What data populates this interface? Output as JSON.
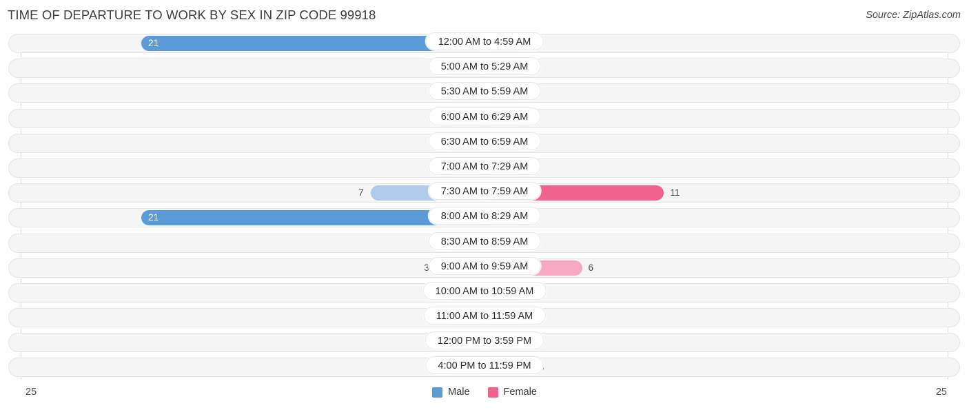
{
  "header": {
    "title": "TIME OF DEPARTURE TO WORK BY SEX IN ZIP CODE 99918",
    "source": "Source: ZipAtlas.com"
  },
  "legend": {
    "male_label": "Male",
    "female_label": "Female",
    "male_color": "#5b9bd8",
    "female_color": "#f2628e"
  },
  "axis": {
    "min_label": "25",
    "max_label": "25",
    "scale_max": 25
  },
  "colors": {
    "male_strong": "#5b9bd8",
    "male_light": "#aecbec",
    "female_strong": "#f2628e",
    "female_light": "#f9a8c4"
  },
  "chart_data": {
    "type": "bar",
    "title": "TIME OF DEPARTURE TO WORK BY SEX IN ZIP CODE 99918",
    "subtitle": "Source: ZipAtlas.com",
    "orientation": "horizontal-diverging",
    "xlabel": "",
    "ylabel": "",
    "xlim": [
      25,
      25
    ],
    "grid": true,
    "legend_position": "bottom-center",
    "categories": [
      "12:00 AM to 4:59 AM",
      "5:00 AM to 5:29 AM",
      "5:30 AM to 5:59 AM",
      "6:00 AM to 6:29 AM",
      "6:30 AM to 6:59 AM",
      "7:00 AM to 7:29 AM",
      "7:30 AM to 7:59 AM",
      "8:00 AM to 8:29 AM",
      "8:30 AM to 8:59 AM",
      "9:00 AM to 9:59 AM",
      "10:00 AM to 10:59 AM",
      "11:00 AM to 11:59 AM",
      "12:00 PM to 3:59 PM",
      "4:00 PM to 11:59 PM"
    ],
    "series": [
      {
        "name": "Male",
        "values": [
          21,
          0,
          0,
          0,
          0,
          0,
          7,
          21,
          0,
          3,
          1,
          0,
          0,
          0
        ]
      },
      {
        "name": "Female",
        "values": [
          1,
          0,
          0,
          0,
          0,
          0,
          11,
          0,
          0,
          6,
          0,
          0,
          0,
          3
        ]
      }
    ]
  },
  "rows": [
    {
      "category": "12:00 AM to 4:59 AM",
      "male": "21",
      "female": "1"
    },
    {
      "category": "5:00 AM to 5:29 AM",
      "male": "0",
      "female": "0"
    },
    {
      "category": "5:30 AM to 5:59 AM",
      "male": "0",
      "female": "0"
    },
    {
      "category": "6:00 AM to 6:29 AM",
      "male": "0",
      "female": "0"
    },
    {
      "category": "6:30 AM to 6:59 AM",
      "male": "0",
      "female": "0"
    },
    {
      "category": "7:00 AM to 7:29 AM",
      "male": "0",
      "female": "0"
    },
    {
      "category": "7:30 AM to 7:59 AM",
      "male": "7",
      "female": "11"
    },
    {
      "category": "8:00 AM to 8:29 AM",
      "male": "21",
      "female": "0"
    },
    {
      "category": "8:30 AM to 8:59 AM",
      "male": "0",
      "female": "0"
    },
    {
      "category": "9:00 AM to 9:59 AM",
      "male": "3",
      "female": "6"
    },
    {
      "category": "10:00 AM to 10:59 AM",
      "male": "1",
      "female": "0"
    },
    {
      "category": "11:00 AM to 11:59 AM",
      "male": "0",
      "female": "0"
    },
    {
      "category": "12:00 PM to 3:59 PM",
      "male": "0",
      "female": "0"
    },
    {
      "category": "4:00 PM to 11:59 PM",
      "male": "0",
      "female": "3"
    }
  ]
}
